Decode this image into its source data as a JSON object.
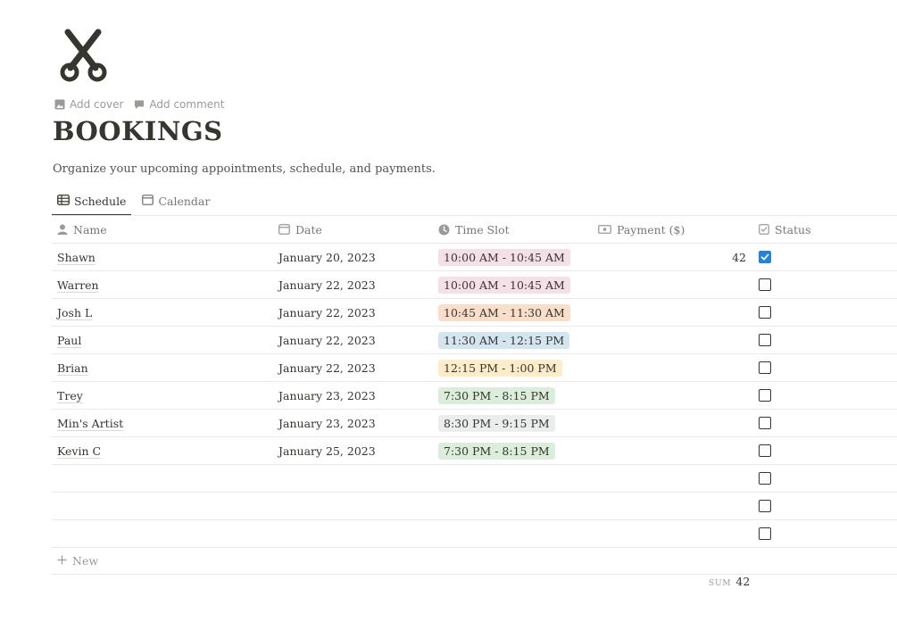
{
  "page": {
    "icon": "scissors-icon",
    "title": "BOOKINGS",
    "description": "Organize your upcoming appointments, schedule, and payments.",
    "actions": {
      "add_cover": "Add cover",
      "add_comment": "Add comment"
    }
  },
  "views": [
    {
      "label": "Schedule",
      "icon": "table-icon",
      "active": true
    },
    {
      "label": "Calendar",
      "icon": "calendar-icon",
      "active": false
    }
  ],
  "columns": {
    "name": "Name",
    "date": "Date",
    "time": "Time Slot",
    "payment": "Payment ($)",
    "status": "Status"
  },
  "rows": [
    {
      "name": "Shawn",
      "date": "January 20, 2023",
      "time": "10:00 AM - 10:45 AM",
      "time_color": "#f5e0e9",
      "payment": "42",
      "status": true
    },
    {
      "name": "Warren",
      "date": "January 22, 2023",
      "time": "10:00 AM - 10:45 AM",
      "time_color": "#f5e0e9",
      "payment": "",
      "status": false
    },
    {
      "name": "Josh L",
      "date": "January 22, 2023",
      "time": "10:45 AM - 11:30 AM",
      "time_color": "#fadec9",
      "payment": "",
      "status": false
    },
    {
      "name": "Paul",
      "date": "January 22, 2023",
      "time": "11:30 AM - 12:15 PM",
      "time_color": "#d3e5ef",
      "payment": "",
      "status": false
    },
    {
      "name": "Brian",
      "date": "January 22, 2023",
      "time": "12:15 PM - 1:00 PM",
      "time_color": "#fdecc8",
      "payment": "",
      "status": false
    },
    {
      "name": "Trey",
      "date": "January 23, 2023",
      "time": "7:30 PM - 8:15 PM",
      "time_color": "#dbeddb",
      "payment": "",
      "status": false
    },
    {
      "name": "Min's Artist",
      "date": "January 23, 2023",
      "time": "8:30 PM - 9:15 PM",
      "time_color": "#ebeced",
      "payment": "",
      "status": false
    },
    {
      "name": "Kevin C",
      "date": "January 25, 2023",
      "time": "7:30 PM - 8:15 PM",
      "time_color": "#dbeddb",
      "payment": "",
      "status": false
    },
    {
      "name": "",
      "date": "",
      "time": "",
      "time_color": "",
      "payment": "",
      "status": false
    },
    {
      "name": "",
      "date": "",
      "time": "",
      "time_color": "",
      "payment": "",
      "status": false
    },
    {
      "name": "",
      "date": "",
      "time": "",
      "time_color": "",
      "payment": "",
      "status": false
    }
  ],
  "new_row_label": "New",
  "footer": {
    "sum_label": "SUM",
    "sum_value": "42"
  },
  "colors": {
    "checkbox_checked": "#2383e2"
  }
}
